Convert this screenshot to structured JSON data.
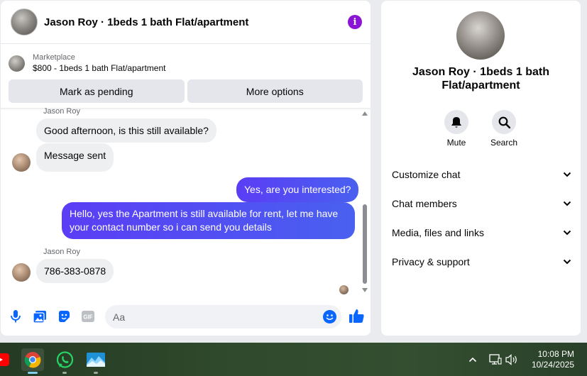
{
  "header": {
    "title": "Jason Roy · 1beds 1 bath Flat/apartment",
    "info_icon": "i"
  },
  "listing": {
    "label": "Marketplace",
    "price_line": "$800 - 1beds 1 bath Flat/apartment",
    "btn_pending": "Mark as pending",
    "btn_more": "More options"
  },
  "messages": {
    "sender_top": "Jason Roy",
    "msg1": "Good afternoon, is this still available?",
    "msg2": "Message sent",
    "out1": "Yes, are you interested?",
    "out2": "Hello, yes the Apartment is still available for rent, let me have your contact number so i can send you details",
    "sender2": "Jason Roy",
    "msg3": "786-383-0878"
  },
  "composer": {
    "placeholder": "Aa"
  },
  "info_panel": {
    "name": "Jason Roy · 1beds 1 bath Flat/apartment",
    "mute": "Mute",
    "search": "Search",
    "menu": [
      "Customize chat",
      "Chat members",
      "Media, files and links",
      "Privacy & support"
    ]
  },
  "taskbar": {
    "time": "10:08 PM",
    "date": "10/24/2025"
  },
  "colors": {
    "accent_purple": "#8b15d4",
    "bubble_out": "#5b3df5",
    "messenger_blue": "#0866ff"
  }
}
